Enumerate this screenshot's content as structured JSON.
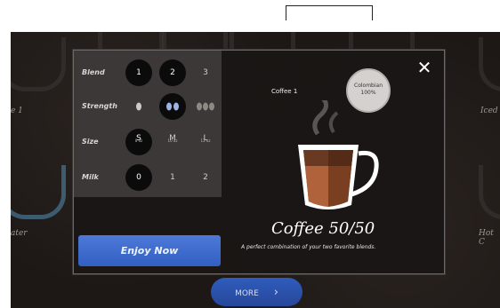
{
  "options": {
    "blend": {
      "label": "Blend",
      "values": [
        "1",
        "2",
        "3"
      ]
    },
    "strength": {
      "label": "Strength",
      "values": [
        "",
        "",
        ""
      ]
    },
    "size": {
      "label": "Size",
      "values": [
        "S",
        "M",
        "L"
      ],
      "sublabels": [
        "8 oz",
        "10 oz",
        "12 oz"
      ]
    },
    "milk": {
      "label": "Milk",
      "values": [
        "0",
        "1",
        "2"
      ]
    }
  },
  "product": {
    "small_title": "Coffee 1",
    "badge_line1": "Colombian",
    "badge_line2": "100%",
    "name": "Coffee 50/50",
    "description": "A perfect combination of your two favorite blends."
  },
  "buttons": {
    "enjoy": "Enjoy Now",
    "more": "MORE",
    "close": "✕"
  },
  "background_labels": {
    "left_top": "e 1",
    "right_top": "Iced",
    "left_bottom": "ater",
    "right_bottom": "Hot C"
  },
  "colors": {
    "button_blue": "#3f6fd0",
    "panel": "#3b3837",
    "background": "#1d1816"
  }
}
